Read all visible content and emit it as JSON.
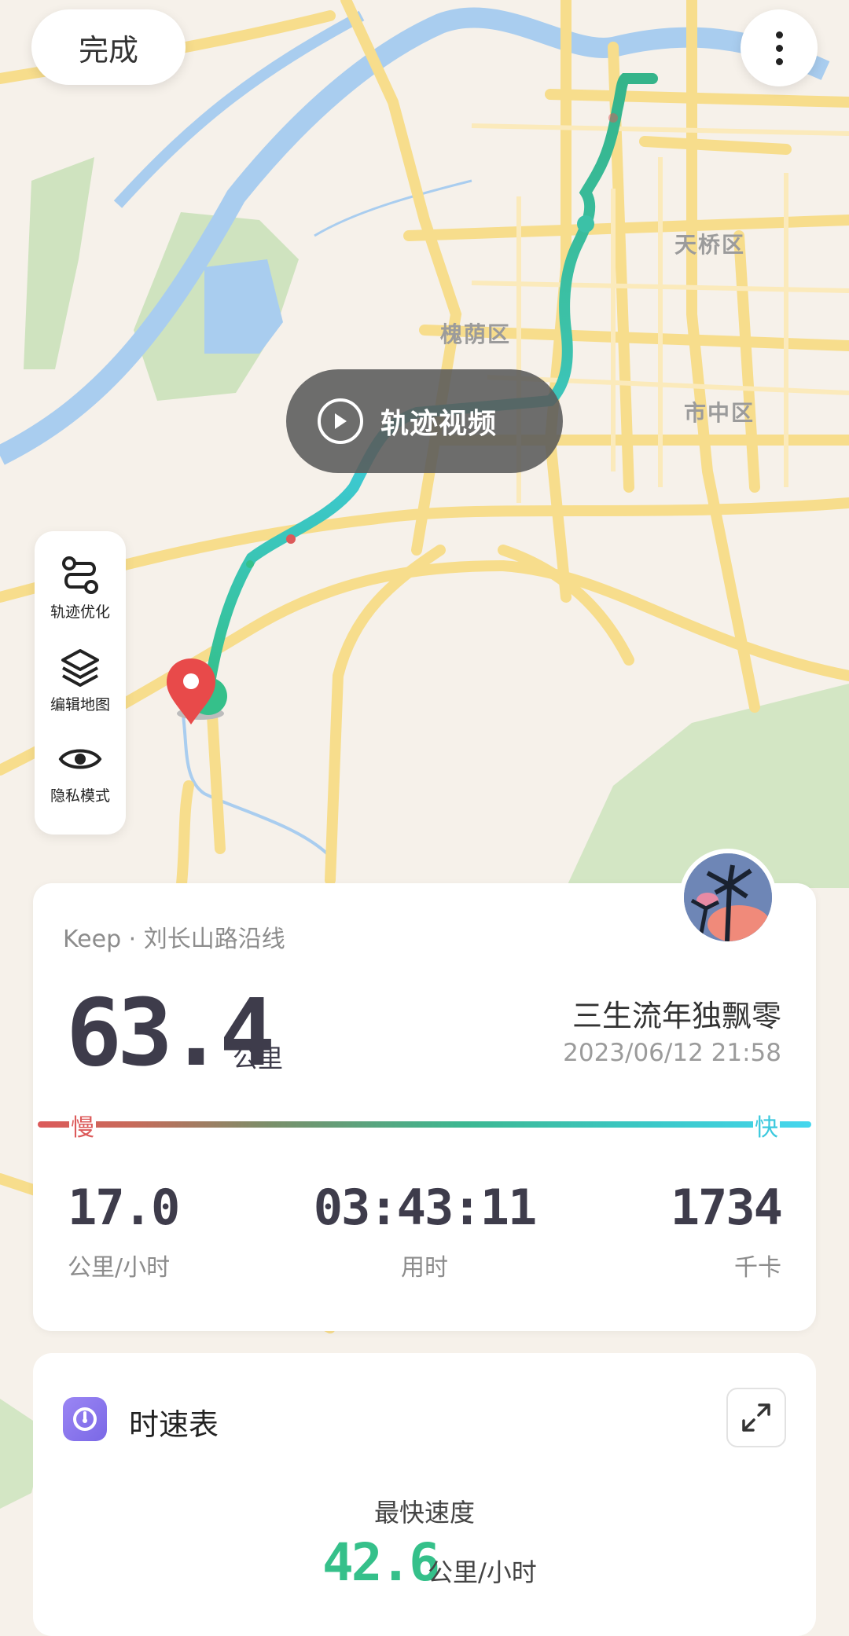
{
  "header": {
    "done_label": "完成"
  },
  "map": {
    "districts": [
      "天桥区",
      "槐荫区",
      "市中区"
    ],
    "video_button_label": "轨迹视频"
  },
  "toolbar": {
    "items": [
      {
        "label": "轨迹优化",
        "icon": "route-optimize-icon"
      },
      {
        "label": "编辑地图",
        "icon": "layers-icon"
      },
      {
        "label": "隐私模式",
        "icon": "eye-icon"
      }
    ]
  },
  "summary": {
    "source": "Keep · 刘长山路沿线",
    "distance": "63.4",
    "distance_unit": "公里",
    "username": "三生流年独飘零",
    "datetime": "2023/06/12 21:58",
    "slow_label": "慢",
    "fast_label": "快",
    "stats": [
      {
        "value": "17.0",
        "label": "公里/小时"
      },
      {
        "value": "03:43:11",
        "label": "用时"
      },
      {
        "value": "1734",
        "label": "千卡"
      }
    ]
  },
  "speedometer": {
    "title": "时速表",
    "max_label": "最快速度",
    "max_value": "42.6",
    "max_unit": "公里/小时"
  },
  "colors": {
    "slow": "#dc5a5a",
    "fast": "#45d6ee",
    "track_green": "#35c08a",
    "marker_red": "#e84a4a"
  }
}
